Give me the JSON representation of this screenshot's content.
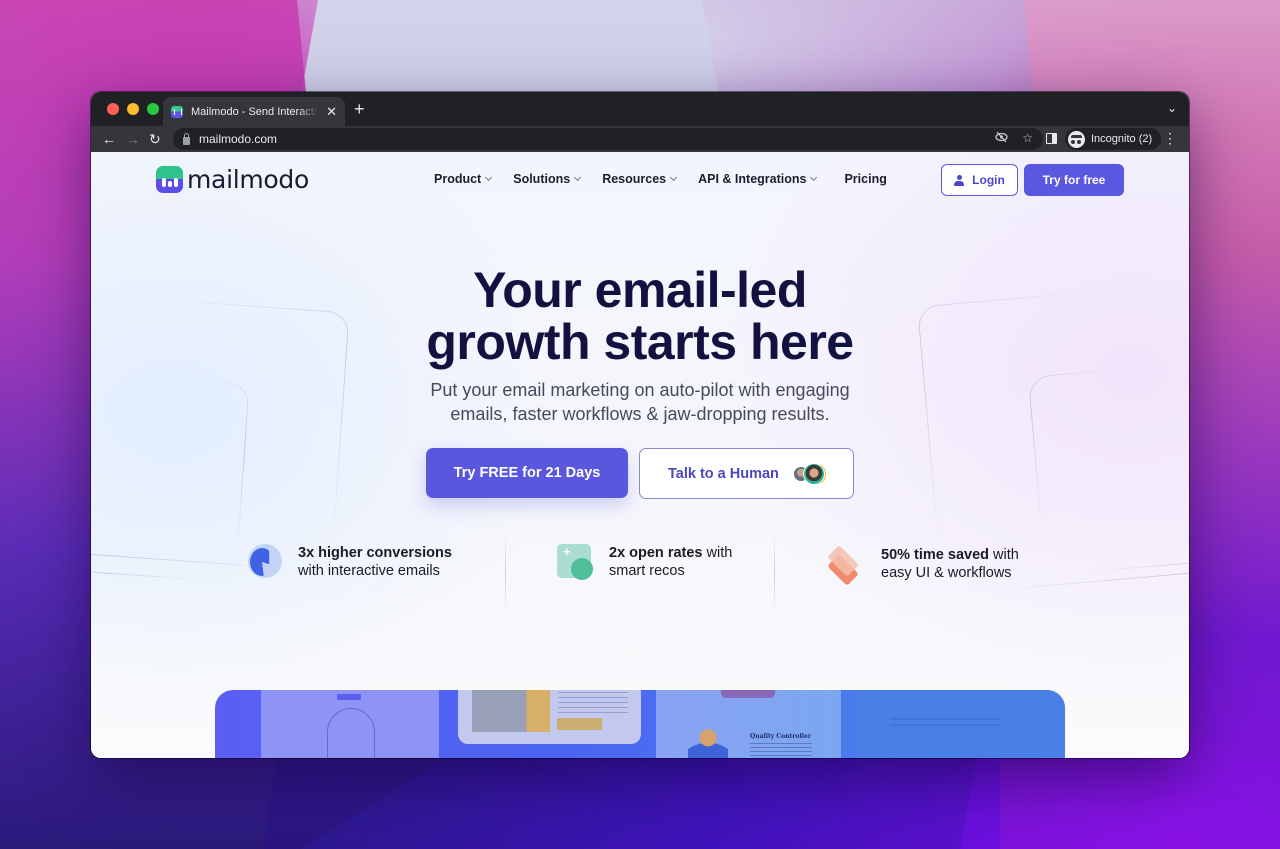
{
  "browser": {
    "tab": {
      "title": "Mailmodo - Send Interactive Emails",
      "favicon": "mailmodo-favicon"
    },
    "new_tab_icon": "+",
    "tab_search_icon": "⌄",
    "close_tab_icon": "✕",
    "nav": {
      "back": "←",
      "forward": "→",
      "reload": "↻"
    },
    "url": "mailmodo.com",
    "omnibox_icons": {
      "eye_off": "◉̸",
      "bookmark": "☆"
    },
    "profile_label": "Incognito (2)",
    "menu_icon": "⋮"
  },
  "site": {
    "brand": "mailmodo",
    "nav": [
      {
        "label": "Product",
        "has_dropdown": true
      },
      {
        "label": "Solutions",
        "has_dropdown": true
      },
      {
        "label": "Resources",
        "has_dropdown": true
      },
      {
        "label": "API & Integrations",
        "has_dropdown": true
      },
      {
        "label": "Pricing",
        "has_dropdown": false
      }
    ],
    "login_label": "Login",
    "try_label": "Try for free",
    "colors": {
      "primary": "#5b57e0",
      "heading": "#111240",
      "brand_green": "#2fc28b"
    }
  },
  "hero": {
    "title_line1": "Your email-led",
    "title_line2": "growth starts here",
    "subtitle_line1": "Put your email marketing on auto-pilot with engaging",
    "subtitle_line2": "emails, faster workflows & jaw-dropping results.",
    "cta_primary": "Try FREE for 21 Days",
    "cta_secondary": "Talk to a Human"
  },
  "stats": [
    {
      "icon": "pie-chart-icon",
      "bold": "3x higher conversions",
      "rest": "",
      "line2": "with interactive emails"
    },
    {
      "icon": "recos-icon",
      "bold": "2x open rates",
      "rest": " with",
      "line2": "smart recos"
    },
    {
      "icon": "layers-icon",
      "bold": "50% time saved",
      "rest": " with",
      "line2": "easy UI & workflows"
    }
  ],
  "showcase": {
    "card3_title": "Quality Controller"
  }
}
